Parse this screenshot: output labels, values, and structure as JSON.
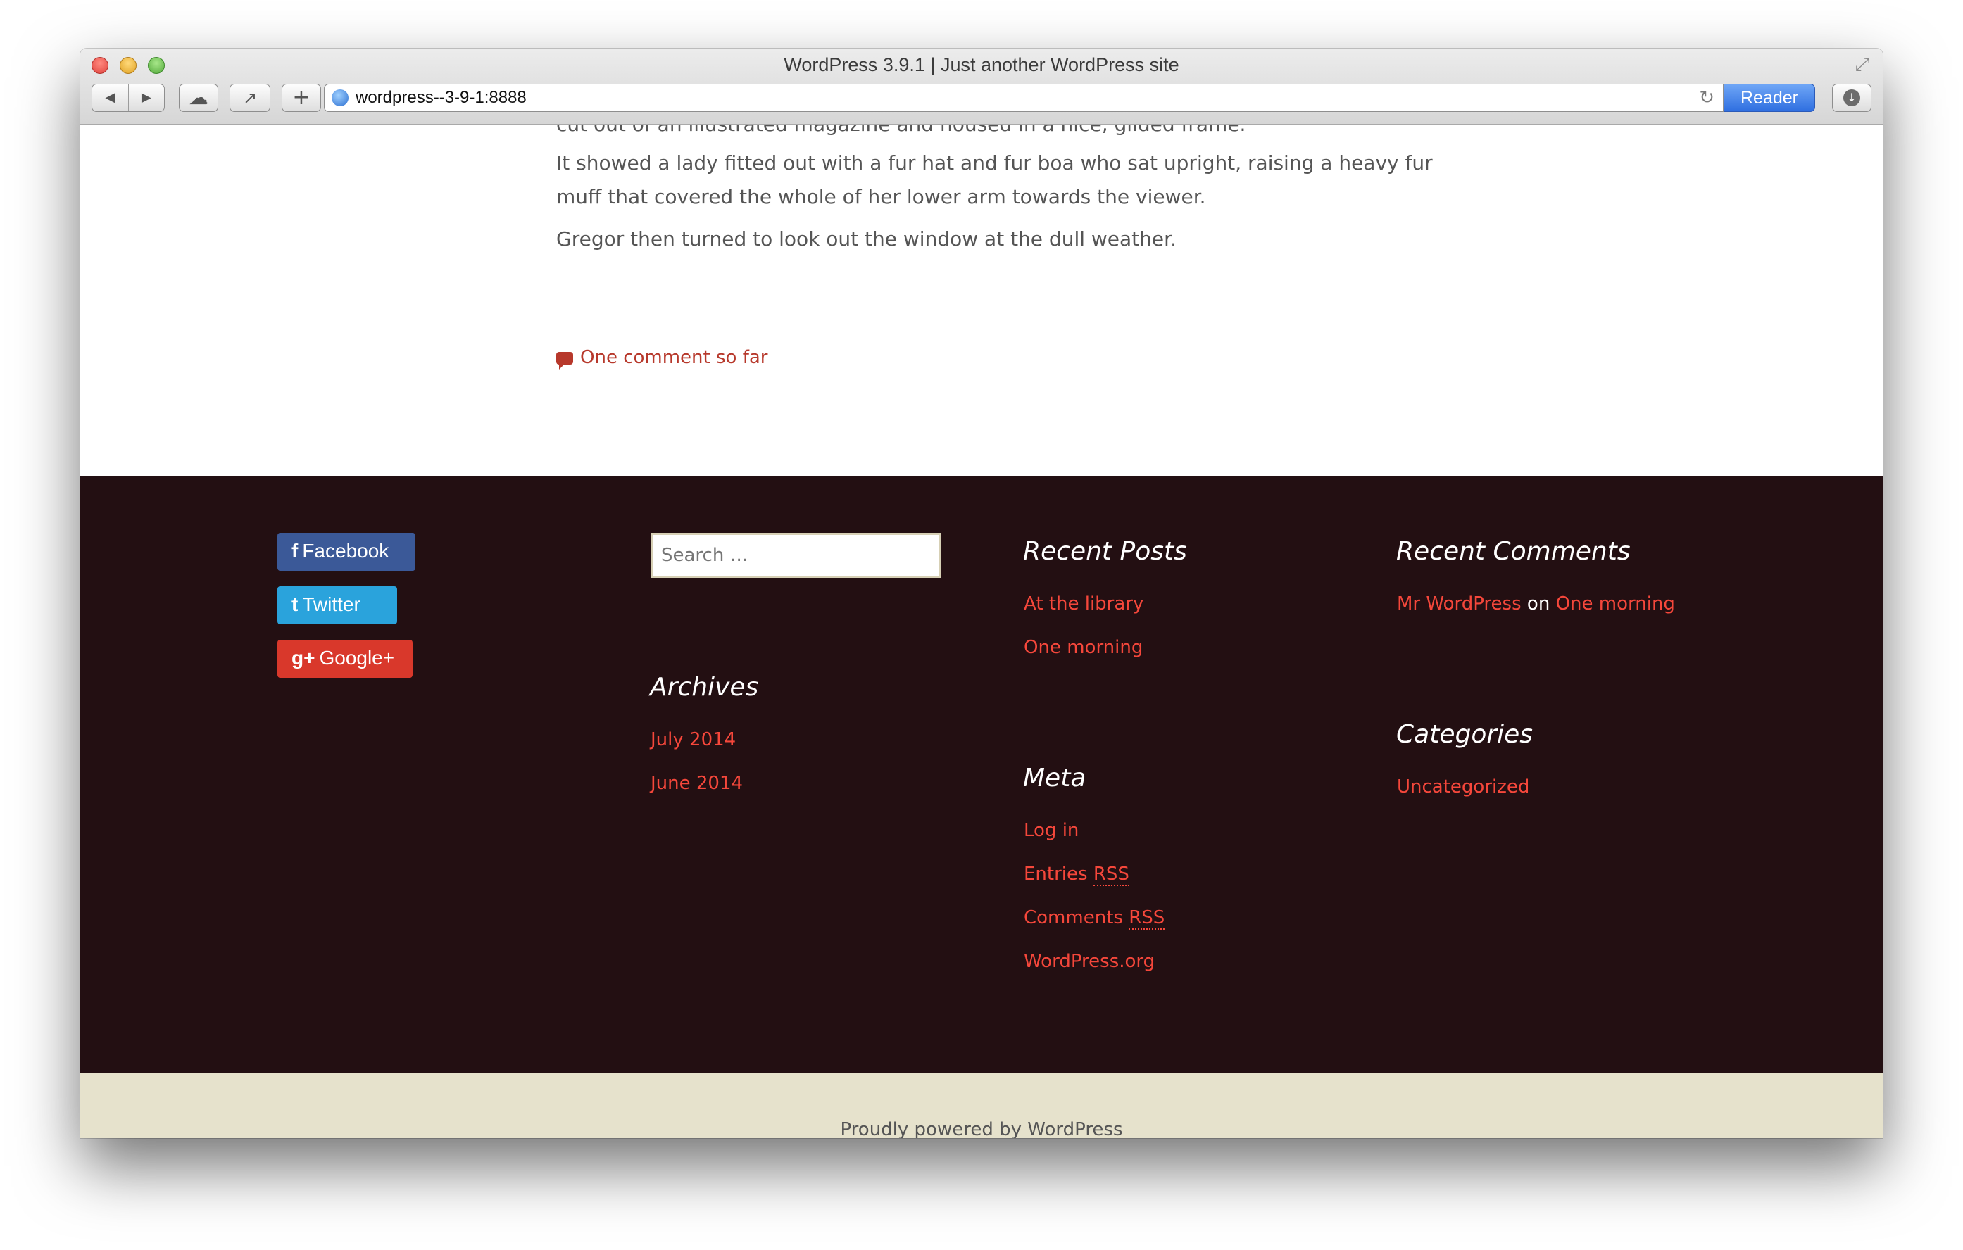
{
  "window": {
    "title": "WordPress 3.9.1 | Just another WordPress site",
    "url": "wordpress--3-9-1:8888",
    "reader_label": "Reader"
  },
  "icons": {
    "back": "◀",
    "forward": "▶",
    "cloud": "☁",
    "share": "↗",
    "newtab": "+",
    "reload": "↻",
    "download": "↓",
    "resize": "⤢"
  },
  "post": {
    "clipped_line": "cut out of an illustrated magazine and housed in a nice, gilded frame.",
    "paragraphs": [
      "It showed a lady fitted out with a fur hat and fur boa who sat upright, raising a heavy fur muff that covered the whole of her lower arm towards the viewer.",
      "Gregor then turned to look out the window at the dull weather."
    ],
    "comment_link": "One comment so far"
  },
  "social": {
    "facebook": {
      "icon": "f",
      "label": "Facebook",
      "color": "#3b5998"
    },
    "twitter": {
      "icon": "t",
      "label": "Twitter",
      "color": "#2aa3dc"
    },
    "googleplus": {
      "icon": "g+",
      "label": "Google+",
      "color": "#d9382b"
    }
  },
  "search": {
    "placeholder": "Search …"
  },
  "archives": {
    "title": "Archives",
    "items": [
      "July 2014",
      "June 2014"
    ]
  },
  "recent_posts": {
    "title": "Recent Posts",
    "items": [
      "At the library",
      "One morning"
    ]
  },
  "meta": {
    "title": "Meta",
    "login": "Log in",
    "entries": "Entries",
    "comments": "Comments",
    "rss": "RSS",
    "wordpress_org": "WordPress.org"
  },
  "recent_comments": {
    "title": "Recent Comments",
    "author": "Mr WordPress",
    "on_word": "on",
    "post": "One morning"
  },
  "categories": {
    "title": "Categories",
    "items": [
      "Uncategorized"
    ]
  },
  "footer": {
    "powered_by": "Proudly powered by WordPress"
  },
  "colors": {
    "footer_dark": "#230f12",
    "footer_light": "#e6e2cc",
    "link_accent": "#f5473b",
    "comment_link": "#b7382b"
  }
}
